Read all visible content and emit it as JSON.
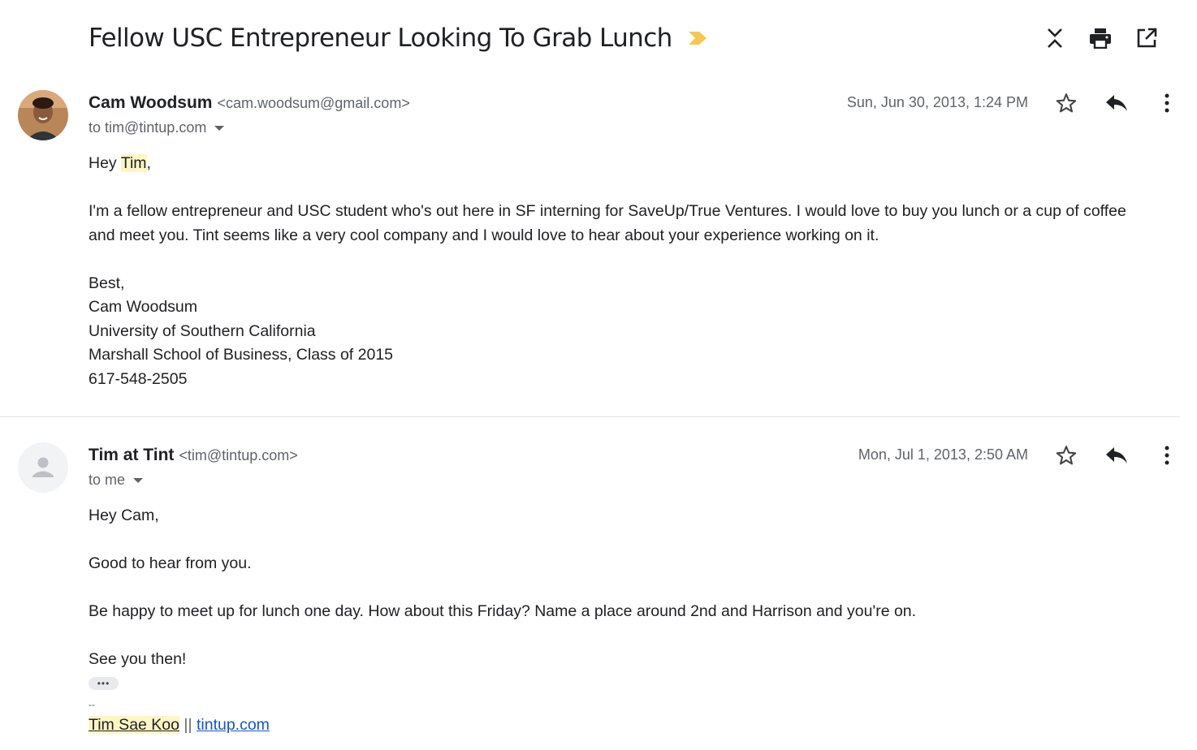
{
  "subject": "Fellow USC Entrepreneur Looking To Grab Lunch",
  "colors": {
    "importance": "#f4c84f",
    "link": "#1155cc",
    "highlight": "#fdf6c3"
  },
  "top_actions": [
    "expand-collapse-icon",
    "print-icon",
    "open-in-new-window-icon"
  ],
  "messages": [
    {
      "sender_name": "Cam Woodsum",
      "sender_email": "<cam.woodsum@gmail.com>",
      "to": "to tim@tintup.com",
      "date": "Sun, Jun 30, 2013, 1:24 PM",
      "greeting_prefix": "Hey ",
      "greeting_name": "Tim",
      "greeting_suffix": ",",
      "para1_line1": "I'm a fellow entrepreneur and USC student who's out here in SF interning for SaveUp/True Ventures.  I would love to buy you lunch or a cup of coffee",
      "para1_line2": "and meet you.  Tint seems like a very cool company and I would love to hear about your experience working on it.",
      "signature": [
        "Best,",
        "Cam Woodsum",
        "University of Southern California",
        "Marshall School of Business, Class of 2015",
        "617-548-2505"
      ]
    },
    {
      "sender_name": "Tim at Tint",
      "sender_email": "<tim@tintup.com>",
      "to": "to me",
      "date": "Mon, Jul 1, 2013, 2:50 AM",
      "greeting": "Hey Cam,",
      "line1": "Good to hear from you.",
      "line2": "Be happy to meet up for lunch one day. How about this Friday? Name a place around 2nd and Harrison and you're on.",
      "line3": "See you then!",
      "trimmed": "•••",
      "sig_dash": "--",
      "sig_name": "Tim Sae Koo",
      "sig_sep": " || ",
      "sig_link": "tintup.com"
    }
  ]
}
